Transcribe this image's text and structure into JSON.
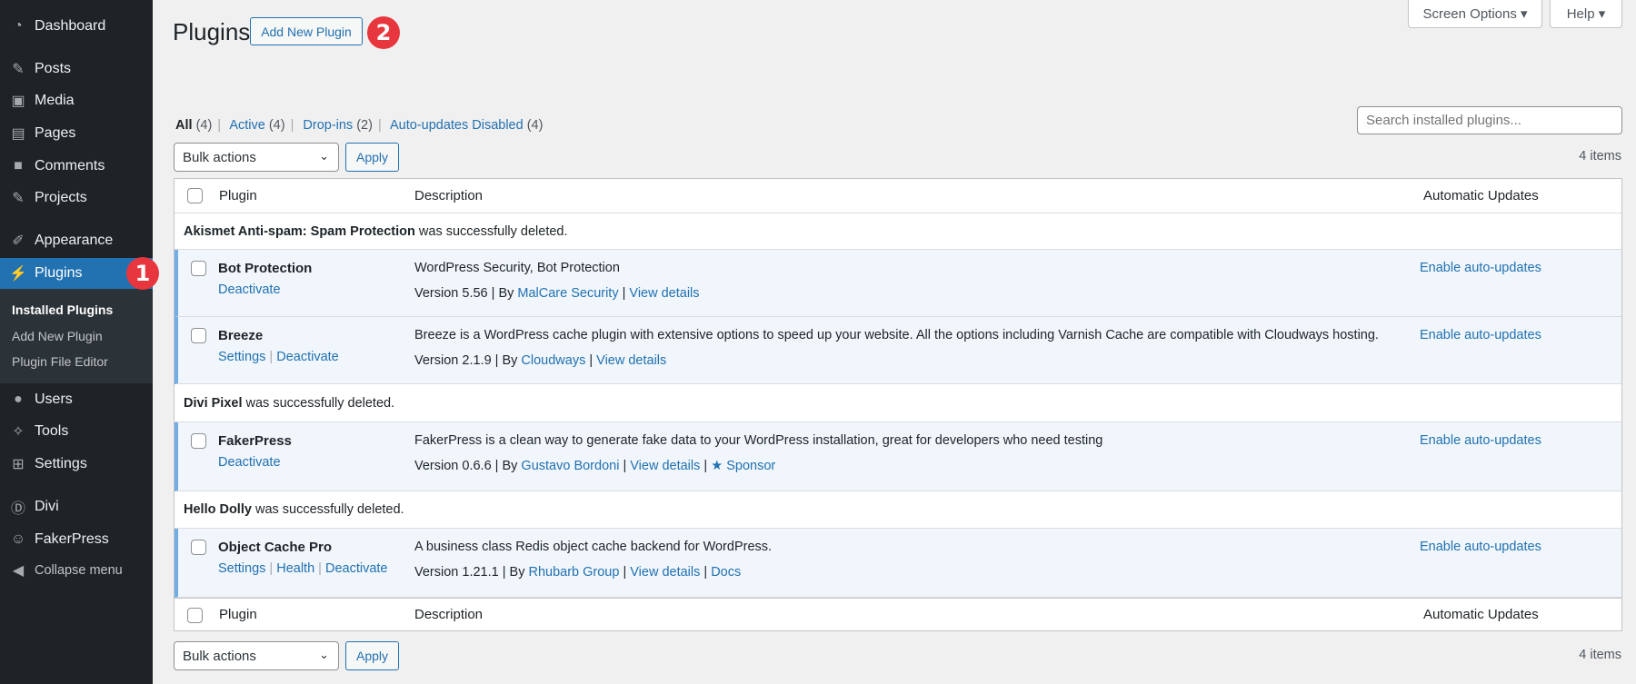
{
  "sidebar": {
    "items": [
      {
        "label": "Dashboard",
        "icon": "dashboard-icon"
      },
      {
        "label": "Posts",
        "icon": "pin-icon"
      },
      {
        "label": "Media",
        "icon": "media-icon"
      },
      {
        "label": "Pages",
        "icon": "pages-icon"
      },
      {
        "label": "Comments",
        "icon": "comment-icon"
      },
      {
        "label": "Projects",
        "icon": "pin-icon"
      },
      {
        "label": "Appearance",
        "icon": "brush-icon"
      },
      {
        "label": "Plugins",
        "icon": "plugin-icon"
      },
      {
        "label": "Users",
        "icon": "user-icon"
      },
      {
        "label": "Tools",
        "icon": "wrench-icon"
      },
      {
        "label": "Settings",
        "icon": "settings-icon"
      },
      {
        "label": "Divi",
        "icon": "divi-icon"
      },
      {
        "label": "FakerPress",
        "icon": "accessibility-icon"
      },
      {
        "label": "Collapse menu",
        "icon": "collapse-icon"
      }
    ],
    "submenu": [
      "Installed Plugins",
      "Add New Plugin",
      "Plugin File Editor"
    ]
  },
  "annotations": {
    "badge1": "1",
    "badge2": "2",
    "color": "#e8363e"
  },
  "header": {
    "title": "Plugins",
    "add_new": "Add New Plugin",
    "screen_options": "Screen Options ▾",
    "help": "Help ▾"
  },
  "filters": {
    "all": "All",
    "all_count": "(4)",
    "active": "Active",
    "active_count": "(4)",
    "dropins": "Drop-ins",
    "dropins_count": "(2)",
    "autoupd": "Auto-updates Disabled",
    "autoupd_count": "(4)"
  },
  "search": {
    "placeholder": "Search installed plugins..."
  },
  "bulk": {
    "label": "Bulk actions",
    "apply": "Apply",
    "count": "4 items"
  },
  "table": {
    "columns": [
      "Plugin",
      "Description",
      "Automatic Updates"
    ],
    "notices": [
      {
        "bold": "Akismet Anti-spam: Spam Protection",
        "text": " was successfully deleted."
      },
      {
        "bold": "Divi Pixel",
        "text": " was successfully deleted."
      },
      {
        "bold": "Hello Dolly",
        "text": " was successfully deleted."
      }
    ],
    "plugins": [
      {
        "name": "Bot Protection",
        "actions": [
          "Deactivate"
        ],
        "description": "WordPress Security, Bot Protection",
        "version": "Version 5.56 | By ",
        "author": "MalCare Security",
        "links": [
          "View details"
        ],
        "auto": "Enable auto-updates"
      },
      {
        "name": "Breeze",
        "actions": [
          "Settings",
          "Deactivate"
        ],
        "description": "Breeze is a WordPress cache plugin with extensive options to speed up your website. All the options including Varnish Cache are compatible with Cloudways hosting.",
        "version": "Version 2.1.9 | By ",
        "author": "Cloudways",
        "links": [
          "View details"
        ],
        "auto": "Enable auto-updates"
      },
      {
        "name": "FakerPress",
        "actions": [
          "Deactivate"
        ],
        "description": "FakerPress is a clean way to generate fake data to your WordPress installation, great for developers who need testing",
        "version": "Version 0.6.6 | By ",
        "author": "Gustavo Bordoni",
        "links": [
          "View details",
          "Sponsor"
        ],
        "auto": "Enable auto-updates"
      },
      {
        "name": "Object Cache Pro",
        "actions": [
          "Settings",
          "Health",
          "Deactivate"
        ],
        "description": "A business class Redis object cache backend for WordPress.",
        "version": "Version 1.21.1 | By ",
        "author": "Rhubarb Group",
        "links": [
          "View details",
          "Docs"
        ],
        "auto": "Enable auto-updates"
      }
    ]
  }
}
